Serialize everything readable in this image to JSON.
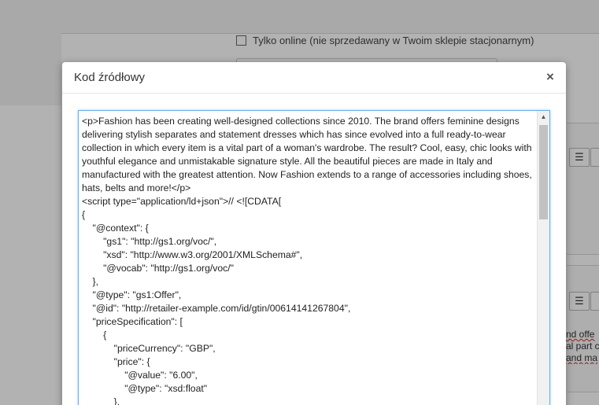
{
  "background": {
    "online_checkbox_label": "Tylko online (nie sprzedawany w Twoim sklepie stacjonarnym)",
    "toolbar_list_icon": "list-icon",
    "snippet_lines": [
      "nd offe",
      "al part c",
      "and ma"
    ]
  },
  "modal": {
    "title": "Kod źródłowy",
    "close_label": "×",
    "source_code": "<p>Fashion has been creating well-designed collections since 2010. The brand offers feminine designs delivering stylish separates and statement dresses which has since evolved into a full ready-to-wear collection in which every item is a vital part of a woman's wardrobe. The result? Cool, easy, chic looks with youthful elegance and unmistakable signature style. All the beautiful pieces are made in Italy and manufactured with the greatest attention. Now Fashion extends to a range of accessories including shoes, hats, belts and more!</p>\n<script type=\"application/ld+json\">// <![CDATA[\n{\n    \"@context\": {\n        \"gs1\": \"http://gs1.org/voc/\",\n        \"xsd\": \"http://www.w3.org/2001/XMLSchema#\",\n        \"@vocab\": \"http://gs1.org/voc/\"\n    },\n    \"@type\": \"gs1:Offer\",\n    \"@id\": \"http://retailer-example.com/id/gtin/00614141267804\",\n    \"priceSpecification\": [\n        {\n            \"priceCurrency\": \"GBP\",\n            \"price\": {\n                \"@value\": \"6.00\",\n                \"@type\": \"xsd:float\"\n            },"
  },
  "colors": {
    "focus_border": "#66afe9",
    "overlay": "rgba(0,0,0,0.30)"
  }
}
